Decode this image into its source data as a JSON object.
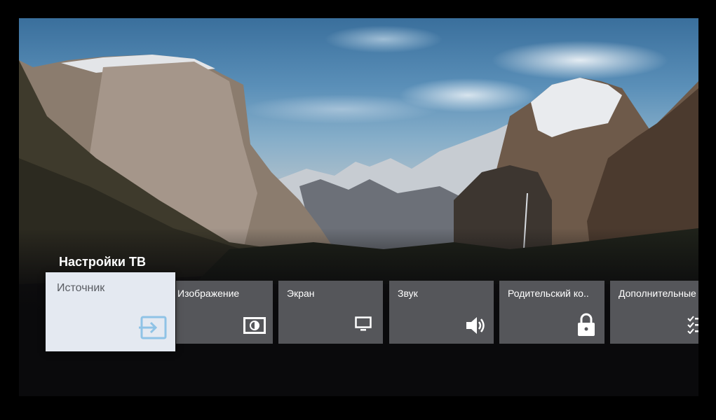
{
  "menu": {
    "title": "Настройки ТВ",
    "tiles": [
      {
        "label": "Источник",
        "icon": "input-source-icon",
        "focused": true
      },
      {
        "label": "Изображение",
        "icon": "picture-icon",
        "focused": false
      },
      {
        "label": "Экран",
        "icon": "monitor-icon",
        "focused": false
      },
      {
        "label": "Звук",
        "icon": "speaker-icon",
        "focused": false
      },
      {
        "label": "Родительский ко..",
        "icon": "lock-icon",
        "focused": false
      },
      {
        "label": "Дополнительные",
        "icon": "checklist-icon",
        "focused": false
      }
    ]
  },
  "colors": {
    "tile_bg": "#55565a",
    "focused_bg": "#e4e9f1",
    "focused_icon": "#8fc3e6",
    "background": "#000000"
  }
}
